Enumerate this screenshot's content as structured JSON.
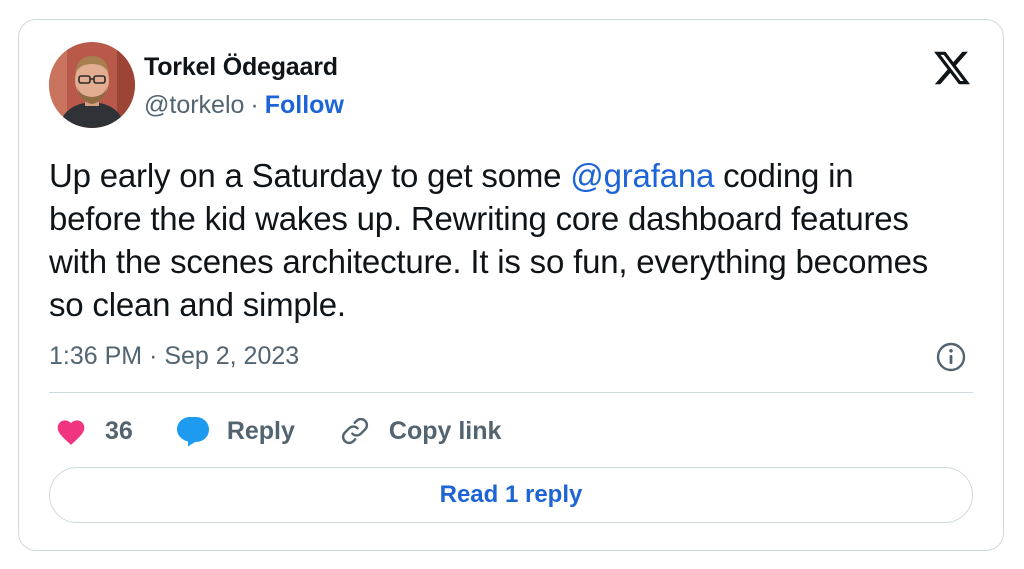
{
  "author": {
    "name": "Torkel Ödegaard",
    "handle": "@torkelo",
    "separator": "·",
    "follow_label": "Follow"
  },
  "tweet": {
    "text_before_mention": "Up early on a Saturday to get some ",
    "mention": "@grafana",
    "text_after_mention": " coding in before the kid wakes up. Rewriting core dashboard features with the scenes architecture. It is so fun, everything becomes so clean and simple.",
    "timestamp": "1:36 PM · Sep 2, 2023"
  },
  "actions": {
    "like_count": "36",
    "reply_label": "Reply",
    "copy_link_label": "Copy link"
  },
  "read_replies_label": "Read 1 reply",
  "icons": {
    "brand": "x-logo-icon",
    "info": "info-icon",
    "like": "heart-icon",
    "reply": "speech-bubble-icon",
    "copy": "link-icon"
  },
  "colors": {
    "accent": "#1d64d6",
    "heart": "#f0347f",
    "bubble": "#1d9bf0",
    "muted": "#536471",
    "border": "#cfd9de"
  }
}
